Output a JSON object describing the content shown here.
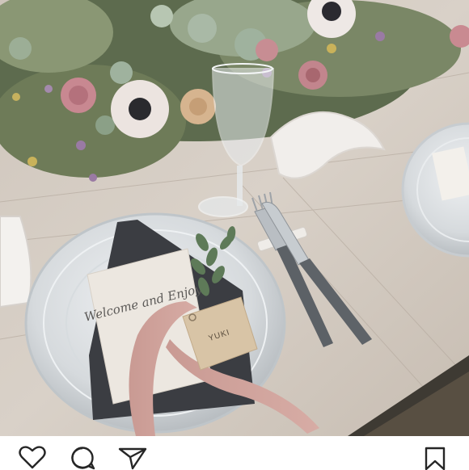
{
  "post": {
    "image": {
      "menu_card_text": "Welcome and Enjoy",
      "name_tag_text": "YUKI"
    },
    "actions": {
      "like_icon": "heart-icon",
      "comment_icon": "comment-icon",
      "share_icon": "paper-plane-icon",
      "save_icon": "bookmark-icon"
    }
  }
}
